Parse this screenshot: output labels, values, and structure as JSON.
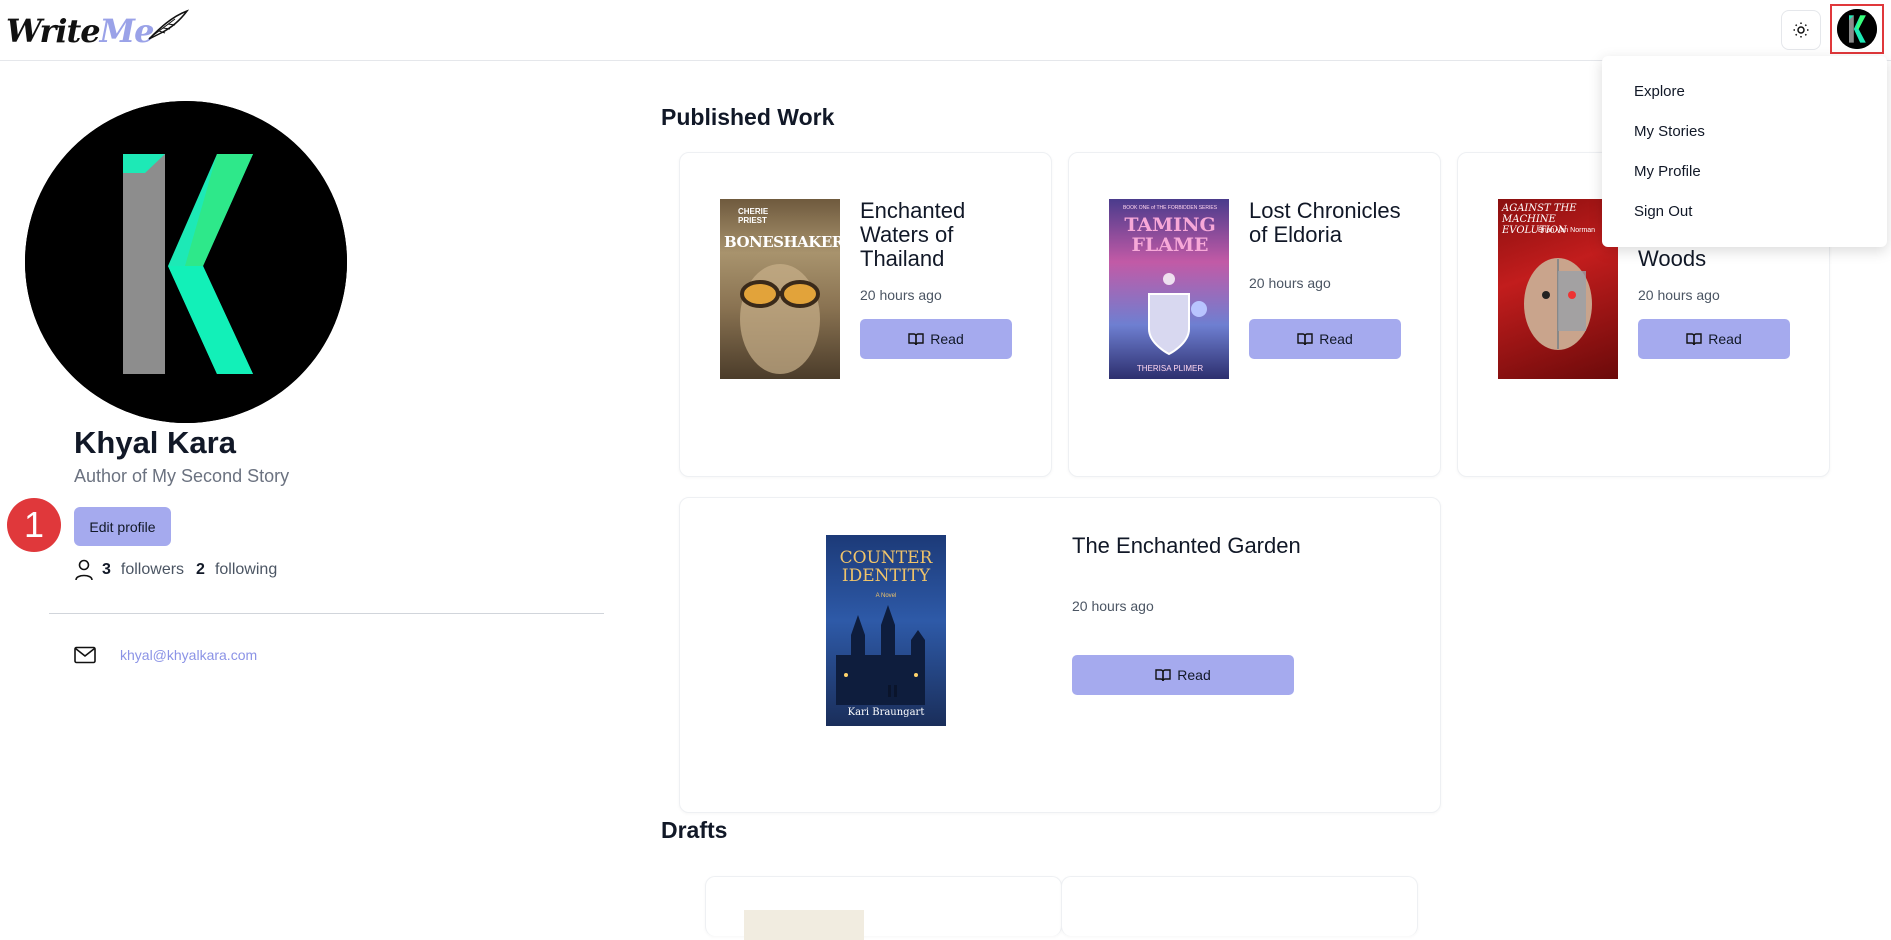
{
  "app": {
    "logo_write": "Write",
    "logo_me": "Me"
  },
  "header": {
    "theme_icon": "sun-icon",
    "avatar_letter": "K"
  },
  "menu": {
    "items": [
      {
        "label": "Explore"
      },
      {
        "label": "My Stories"
      },
      {
        "label": "My Profile"
      },
      {
        "label": "Sign Out"
      }
    ]
  },
  "profile": {
    "name": "Khyal Kara",
    "subtitle": "Author of My Second Story",
    "edit_label": "Edit profile",
    "annotation_number": "1",
    "followers_count": "3",
    "followers_label": "followers",
    "following_count": "2",
    "following_label": "following",
    "email": "khyal@khyalkara.com"
  },
  "published": {
    "title": "Published Work",
    "books": [
      {
        "title": "Enchanted Waters of Thailand",
        "time": "20 hours ago",
        "read_label": "Read",
        "cover_top": "CHERIE PRIEST",
        "cover_main": "BONESHAKER"
      },
      {
        "title": "Lost Chronicles of Eldoria",
        "time": "20 hours ago",
        "read_label": "Read",
        "cover_top": "BOOK ONE of THE FORBIDDEN SERIES",
        "cover_main": "TAMING FLAME",
        "cover_bottom": "THERISA PLIMER"
      },
      {
        "title": "Woods",
        "time": "20 hours ago",
        "read_label": "Read",
        "cover_top": "AGAINST THE MACHINE EVOLUTION",
        "cover_sub": "Brian Van Norman"
      },
      {
        "title": "The Enchanted Garden",
        "time": "20 hours ago",
        "read_label": "Read",
        "cover_main": "COUNTER IDENTITY",
        "cover_sub": "A Novel",
        "cover_bottom": "Kari Braungart"
      }
    ]
  },
  "drafts": {
    "title": "Drafts"
  },
  "colors": {
    "accent": "#a5aaee",
    "link": "#8b93e6",
    "highlight": "#e0383b"
  }
}
